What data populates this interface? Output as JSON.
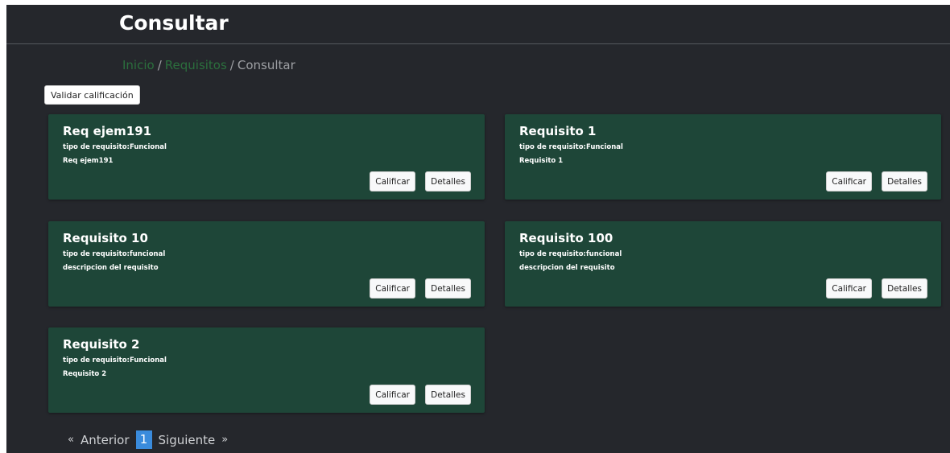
{
  "header": {
    "title": "Consultar"
  },
  "breadcrumb": {
    "items": [
      "Inicio",
      "Requisitos",
      "Consultar"
    ],
    "separator": "/"
  },
  "toolbar": {
    "validate_label": "Validar calificación"
  },
  "cards": [
    {
      "title": "Req ejem191",
      "type": "tipo de requisito:Funcional",
      "description": "Req ejem191",
      "grade_label": "Calificar",
      "details_label": "Detalles"
    },
    {
      "title": "Requisito 1",
      "type": "tipo de requisito:Funcional",
      "description": "Requisito 1",
      "grade_label": "Calificar",
      "details_label": "Detalles"
    },
    {
      "title": "Requisito 10",
      "type": "tipo de requisito:funcional",
      "description": "descripcion del requisito",
      "grade_label": "Calificar",
      "details_label": "Detalles"
    },
    {
      "title": "Requisito 100",
      "type": "tipo de requisito:funcional",
      "description": "descripcion del requisito",
      "grade_label": "Calificar",
      "details_label": "Detalles"
    },
    {
      "title": "Requisito 2",
      "type": "tipo de requisito:Funcional",
      "description": "Requisito 2",
      "grade_label": "Calificar",
      "details_label": "Detalles"
    }
  ],
  "pagination": {
    "prev_arrow": "«",
    "prev_label": "Anterior",
    "current_page": "1",
    "next_label": "Siguiente",
    "next_arrow": "»"
  },
  "colors": {
    "background": "#25272c",
    "card": "#1e4638",
    "breadcrumb_link": "#2b6f3d",
    "current_page": "#3a8bdc"
  }
}
